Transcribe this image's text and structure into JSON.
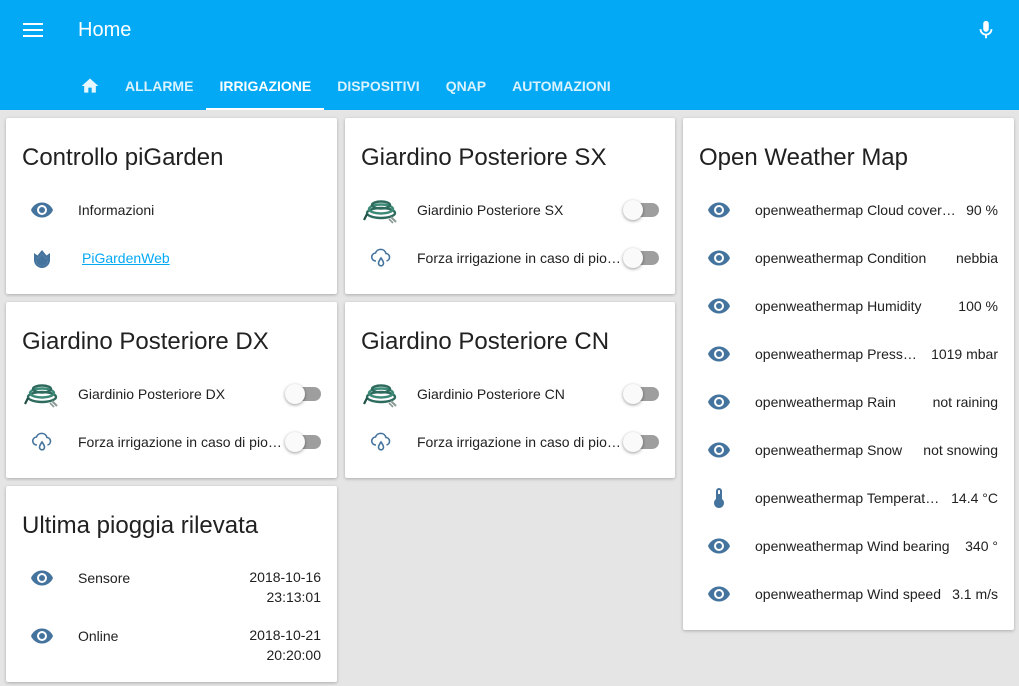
{
  "header": {
    "title": "Home"
  },
  "tabs": [
    {
      "label": "ALLARME"
    },
    {
      "label": "IRRIGAZIONE"
    },
    {
      "label": "DISPOSITIVI"
    },
    {
      "label": "QNAP"
    },
    {
      "label": "AUTOMAZIONI"
    }
  ],
  "colors": {
    "header": "#03a9f4",
    "icon": "#44739e",
    "link": "#03a9f4",
    "background": "#e5e5e5"
  },
  "cards": {
    "controllo": {
      "title": "Controllo piGarden",
      "rows": [
        {
          "icon": "eye-icon",
          "label": "Informazioni"
        },
        {
          "icon": "tulip-icon",
          "label": "PiGardenWeb"
        }
      ]
    },
    "giardino_sx": {
      "title": "Giardino Posteriore SX",
      "rows": [
        {
          "icon": "garden-hose-icon",
          "label": "Giardinio Posteriore SX",
          "state": "off"
        },
        {
          "icon": "rain-cloud-icon",
          "label": "Forza irrigazione in caso di pioggia",
          "state": "off"
        }
      ]
    },
    "giardino_dx": {
      "title": "Giardino Posteriore DX",
      "rows": [
        {
          "icon": "garden-hose-icon",
          "label": "Giardinio Posteriore DX",
          "state": "off"
        },
        {
          "icon": "rain-cloud-icon",
          "label": "Forza irrigazione in caso di pioggia",
          "state": "off"
        }
      ]
    },
    "giardino_cn": {
      "title": "Giardino Posteriore CN",
      "rows": [
        {
          "icon": "garden-hose-icon",
          "label": "Giardinio Posteriore CN",
          "state": "off"
        },
        {
          "icon": "rain-cloud-icon",
          "label": "Forza irrigazione in caso di pioggia",
          "state": "off"
        }
      ]
    },
    "pioggia": {
      "title": "Ultima pioggia rilevata",
      "rows": [
        {
          "icon": "eye-icon",
          "label": "Sensore",
          "date": "2018-10-16",
          "time": "23:13:01"
        },
        {
          "icon": "eye-icon",
          "label": "Online",
          "date": "2018-10-21",
          "time": "20:20:00"
        }
      ]
    },
    "weather": {
      "title": "Open Weather Map",
      "rows": [
        {
          "icon": "eye-icon",
          "label": "openweathermap Cloud coverage",
          "value": "90 %"
        },
        {
          "icon": "eye-icon",
          "label": "openweathermap Condition",
          "value": "nebbia"
        },
        {
          "icon": "eye-icon",
          "label": "openweathermap Humidity",
          "value": "100 %"
        },
        {
          "icon": "eye-icon",
          "label": "openweathermap Pressure",
          "value": "1019 mbar"
        },
        {
          "icon": "eye-icon",
          "label": "openweathermap Rain",
          "value": "not raining"
        },
        {
          "icon": "eye-icon",
          "label": "openweathermap Snow",
          "value": "not snowing"
        },
        {
          "icon": "thermometer-icon",
          "label": "openweathermap Temperature",
          "value": "14.4 °C"
        },
        {
          "icon": "eye-icon",
          "label": "openweathermap Wind bearing",
          "value": "340 °"
        },
        {
          "icon": "eye-icon",
          "label": "openweathermap Wind speed",
          "value": "3.1 m/s"
        }
      ]
    }
  }
}
